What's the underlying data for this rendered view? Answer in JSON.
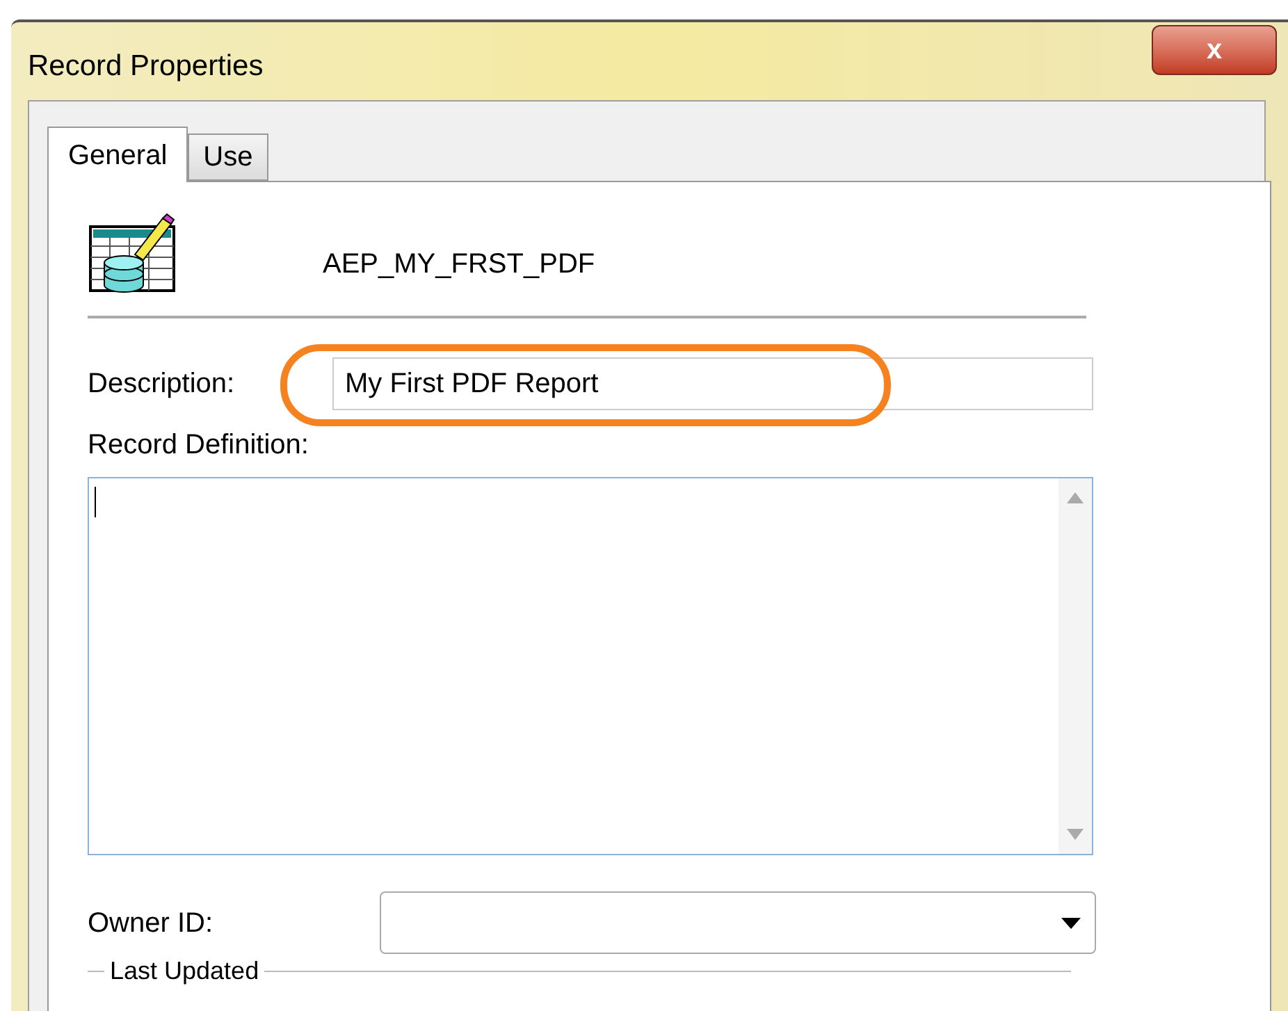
{
  "window": {
    "title": "Record Properties",
    "close": "x"
  },
  "tabs": [
    {
      "label": "General",
      "selected": true
    },
    {
      "label": "Use",
      "selected": false
    }
  ],
  "record": {
    "name": "AEP_MY_FRST_PDF"
  },
  "description": {
    "label": "Description:",
    "value": "My First PDF Report",
    "highlighted": true
  },
  "record_definition": {
    "label": "Record Definition:"
  },
  "owner_id": {
    "label": "Owner ID:"
  },
  "last_updated": {
    "label": "Last Updated"
  }
}
